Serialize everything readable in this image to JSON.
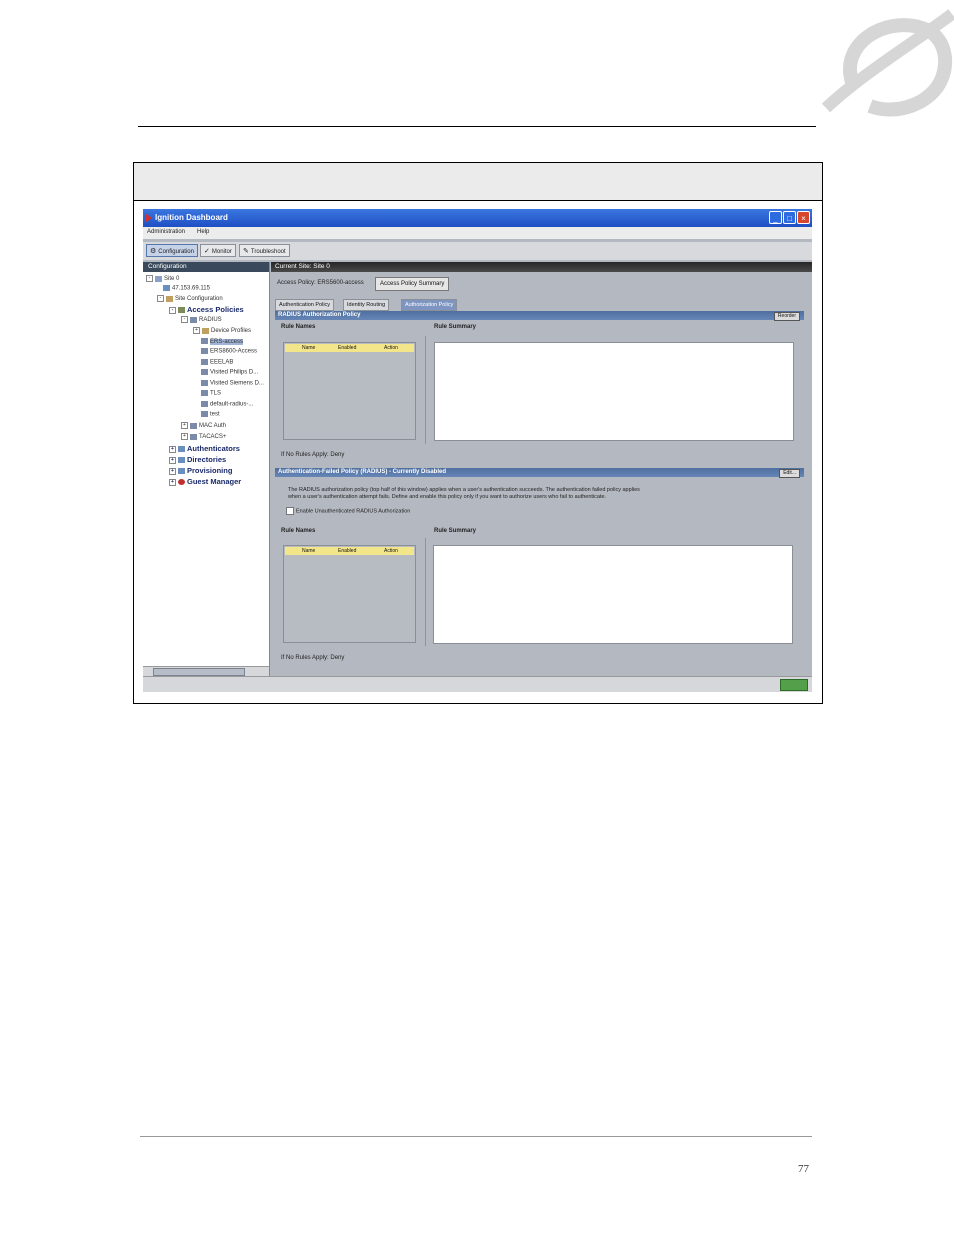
{
  "page_number": "77",
  "window": {
    "title": "Ignition Dashboard",
    "menu": [
      "Administration",
      "Help"
    ],
    "toolbar": [
      "Configuration",
      "Monitor",
      "Troubleshoot"
    ]
  },
  "left_pane": {
    "header": "Configuration",
    "tree": [
      "Site 0",
      "47.153.69.115",
      "Site Configuration",
      "Access Policies",
      "RADIUS",
      "Device Profiles",
      "ERS-access",
      "ERS8600-Access",
      "EEELAB",
      "Visited Philips D...",
      "Visited Siemens D...",
      "TLS",
      "default-radius-...",
      "test",
      "MAC Auth",
      "TACACS+",
      "Authenticators",
      "Directories",
      "Provisioning",
      "Guest Manager"
    ]
  },
  "right_pane": {
    "header": "Current Site: Site 0",
    "access_policy_label": "Access Policy: ERS5600-access",
    "access_policy_button": "Access Policy Summary",
    "tabs": [
      "Authentication Policy",
      "Identity Routing",
      "Authorization Policy"
    ],
    "section1": {
      "title": "RADIUS Authorization Policy",
      "button": "Reorder",
      "rule_names_label": "Rule Names",
      "rule_summary_label": "Rule Summary",
      "columns": [
        "Name",
        "Enabled",
        "Action"
      ],
      "if_no_rules": "If No Rules Apply: Deny"
    },
    "section2": {
      "title": "Authentication-Failed Policy (RADIUS) - Currently Disabled",
      "button": "Edit...",
      "description_line1": "The RADIUS authorization policy (top half of this window) applies when a user's authentication succeeds. The authentication failed policy applies",
      "description_line2": "when a user's authentication attempt fails. Define and enable this policy only if you want to authorize users who fail to authenticate.",
      "checkbox_label": "Enable Unauthenticated RADIUS Authorization",
      "rule_names_label": "Rule Names",
      "rule_summary_label": "Rule Summary",
      "columns": [
        "Name",
        "Enabled",
        "Action"
      ],
      "if_no_rules": "If No Rules Apply: Deny"
    }
  }
}
